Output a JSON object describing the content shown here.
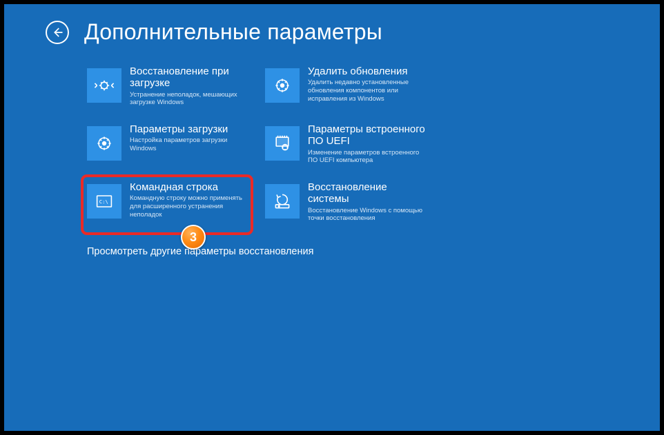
{
  "header": {
    "title": "Дополнительные параметры"
  },
  "tiles": {
    "startup_repair": {
      "title": "Восстановление при загрузке",
      "desc": "Устранение неполадок, мешающих загрузке Windows"
    },
    "uninstall_updates": {
      "title": "Удалить обновления",
      "desc": "Удалить недавно установленные обновления компонентов или исправления из Windows"
    },
    "startup_settings": {
      "title": "Параметры загрузки",
      "desc": "Настройка параметров загрузки Windows"
    },
    "uefi": {
      "title": "Параметры встроенного ПО UEFI",
      "desc": "Изменение параметров встроенного ПО UEFI компьютера"
    },
    "cmd": {
      "title": "Командная строка",
      "desc": "Командную строку можно применять для расширенного устранения неполадок"
    },
    "system_restore": {
      "title": "Восстановление системы",
      "desc": "Восстановление Windows с помощью точки восстановления"
    }
  },
  "more_link": "Просмотреть другие параметры восстановления",
  "annotation": {
    "badge": "3"
  }
}
